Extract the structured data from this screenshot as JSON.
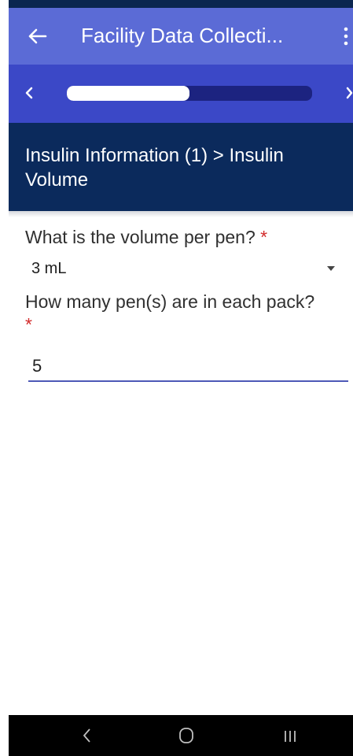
{
  "app_bar": {
    "title": "Facility Data Collecti...",
    "back_icon": "arrow-left-icon",
    "menu_icon": "more-vert-icon",
    "background": "#5b6bd6"
  },
  "progress": {
    "fraction": 0.5,
    "prev_icon": "chevron-left-icon",
    "next_icon": "chevron-right-icon",
    "background": "#3b48c7",
    "track_color": "#1c2380",
    "fill_color": "#ffffff"
  },
  "section": {
    "title": "Insulin Information (1) > Insulin Volume",
    "background": "#0b2a5c"
  },
  "questions": [
    {
      "label": "What is the volume per pen?",
      "required_marker": "*",
      "type": "select",
      "selected_value": "3 mL",
      "icon": "dropdown-arrow-icon"
    },
    {
      "label": "How many pen(s) are in each pack?",
      "required_marker": "*",
      "type": "text",
      "value": "5",
      "underline_color": "#4e59b7"
    }
  ],
  "colors": {
    "required": "#d22b2b"
  },
  "system_nav": {
    "back_icon": "nav-back-icon",
    "home_icon": "nav-home-icon",
    "recent_icon": "nav-recent-apps-icon"
  }
}
